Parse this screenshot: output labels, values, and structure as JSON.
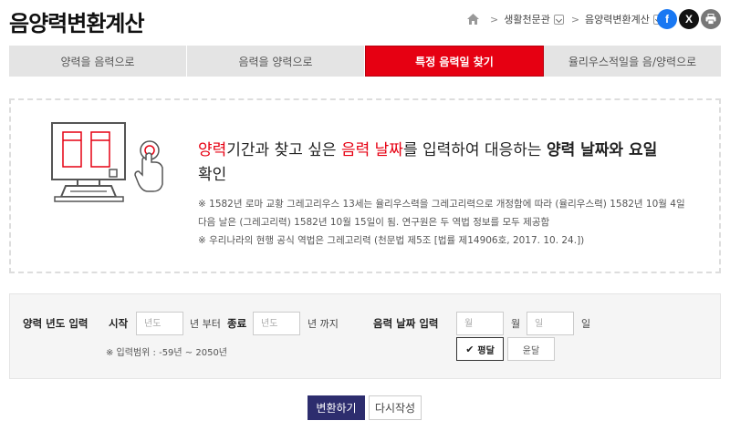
{
  "header": {
    "title": "음양력변환계산",
    "breadcrumb": [
      "생활천문관",
      "음양력변환계산"
    ],
    "social": {
      "facebook": "f",
      "x": "X"
    }
  },
  "tabs": [
    {
      "label": "양력을 음력으로",
      "active": false
    },
    {
      "label": "음력을 양력으로",
      "active": false
    },
    {
      "label": "특정 음력일 찾기",
      "active": true
    },
    {
      "label": "율리우스적일을 음/양력으로",
      "active": false
    }
  ],
  "info": {
    "headline": {
      "p1": "양력",
      "p2": "기간과 찾고 싶은 ",
      "p3": "음력 날짜",
      "p4": "를 입력하여 대응하는 ",
      "p5": "양력 날짜와 요일",
      "p6": "확인"
    },
    "notes": [
      "※ 1582년 로마 교황 그레고리우스 13세는 율리우스력을 그레고리력으로 개정함에 따라 (율리우스력) 1582년 10월 4일",
      "다음 날은 (그레고리력) 1582년 10월 15일이 됨. 연구원은 두 역법 정보를 모두 제공함",
      "※ 우리나라의 현행 공식 역법은 그레고리력 (천문법 제5조 [법률 제14906호, 2017. 10. 24.])"
    ]
  },
  "form": {
    "solar_label": "양력 년도 입력",
    "start_label": "시작",
    "start_placeholder": "년도",
    "start_suffix": "년 부터",
    "end_label": "종료",
    "end_placeholder": "년도",
    "end_suffix": "년 까지",
    "range_note": "※ 입력범위 : -59년 ~ 2050년",
    "lunar_label": "음력 날짜 입력",
    "month_placeholder": "월",
    "month_suffix": "월",
    "day_placeholder": "일",
    "day_suffix": "일",
    "normal_month": "평달",
    "leap_month": "윤달"
  },
  "actions": {
    "convert": "변환하기",
    "reset": "다시작성"
  },
  "colors": {
    "accent": "#e60012",
    "primary_button": "#2d2d6e"
  }
}
